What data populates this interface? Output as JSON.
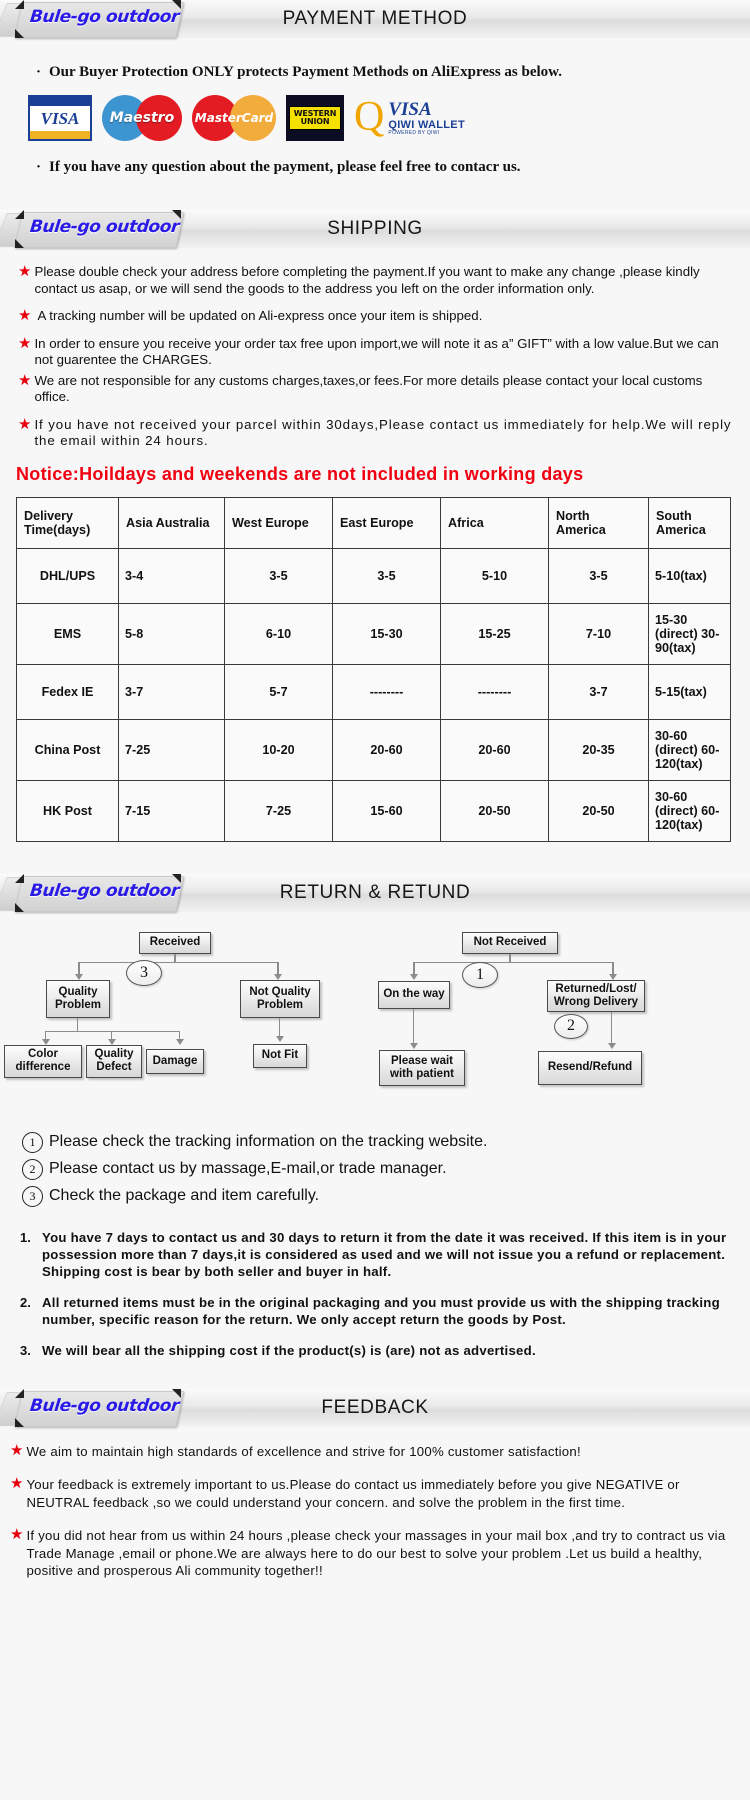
{
  "brand": "Bule-go outdoor",
  "sections": {
    "payment": {
      "title": "PAYMENT METHOD",
      "line1": "Our Buyer Protection ONLY protects Payment Methods on AliExpress as below.",
      "line2": "If you have any question about the payment, please feel free to contacr us.",
      "cards": [
        {
          "name": "visa-card-logo",
          "label": "VISA"
        },
        {
          "name": "maestro-card-logo",
          "label": "Maestro"
        },
        {
          "name": "mastercard-card-logo",
          "label": "MasterCard"
        },
        {
          "name": "western-union-logo",
          "label1": "WESTERN",
          "label2": "UNION"
        },
        {
          "name": "qiwi-wallet-logo",
          "label": "VISA",
          "sub": "QIWI WALLET",
          "fine": "POWERED BY QIWI"
        }
      ]
    },
    "shipping": {
      "title": "SHIPPING",
      "bullets": [
        "Please double check your address before completing the payment.If you want to make any change ,please kindly contact us asap, or we will send the goods to the address you left on the order information only.",
        "A tracking number will be updated on Ali-express once your item is shipped.",
        "In order to ensure you receive your order tax free upon import,we will note it as a” GIFT” with a low value.But we can not guarentee the CHARGES.",
        "We are not responsible for any customs charges,taxes,or fees.For more details please contact your local customs office.",
        "If you have not received your parcel within 30days,Please contact us immediately for help.We will reply the email within 24 hours."
      ],
      "notice": "Notice:Hoildays and weekends are not included in working days",
      "table": {
        "headers": [
          "Delivery Time(days)",
          "Asia Australia",
          "West Europe",
          "East Europe",
          "Africa",
          "North America",
          "South America"
        ],
        "rows": [
          {
            "method": "DHL/UPS",
            "cells": [
              "3-4",
              "3-5",
              "3-5",
              "5-10",
              "3-5",
              "5-10(tax)"
            ]
          },
          {
            "method": "EMS",
            "cells": [
              "5-8",
              "6-10",
              "15-30",
              "15-25",
              "7-10",
              "15-30 (direct) 30-90(tax)"
            ]
          },
          {
            "method": "Fedex IE",
            "cells": [
              "3-7",
              "5-7",
              "--------",
              "--------",
              "3-7",
              "5-15(tax)"
            ]
          },
          {
            "method": "China Post",
            "cells": [
              "7-25",
              "10-20",
              "20-60",
              "20-60",
              "20-35",
              "30-60 (direct) 60-120(tax)"
            ]
          },
          {
            "method": "HK Post",
            "cells": [
              "7-15",
              "7-25",
              "15-60",
              "20-50",
              "20-50",
              "30-60 (direct) 60-120(tax)"
            ]
          }
        ]
      }
    },
    "return": {
      "title": "RETURN & RETUND",
      "flow": {
        "received": "Received",
        "quality_problem": "Quality Problem",
        "not_quality_problem": "Not Quality Problem",
        "color_difference": "Color difference",
        "quality_defect": "Quality Defect",
        "damage": "Damage",
        "not_fit": "Not Fit",
        "not_received": "Not  Received",
        "on_the_way": "On the way",
        "returned_lost": "Returned/Lost/ Wrong Delivery",
        "please_wait": "Please wait with patient",
        "resend_refund": "Resend/Refund",
        "marker1": "1",
        "marker2": "2",
        "marker3": "3"
      },
      "numbered": [
        {
          "n": "①",
          "text": "Please check the tracking information on the tracking website."
        },
        {
          "n": "②",
          "text": "Please contact us by  massage,E-mail,or trade manager."
        },
        {
          "n": "③",
          "text": "Check the package and item carefully."
        }
      ],
      "policies": [
        {
          "n": "1.",
          "text": "You have 7 days to contact us and 30 days to return it from the date it was received. If this item is in your possession more than 7 days,it is considered as used and we will not issue you a refund or replacement. Shipping cost is bear by both seller and buyer in half."
        },
        {
          "n": "2.",
          "text": "All returned items must be in the original packaging and you must provide us with the shipping tracking number, specific reason for the return. We only accept return the goods by Post."
        },
        {
          "n": "3.",
          "text": "We will bear all the shipping cost if the product(s) is (are) not as advertised."
        }
      ]
    },
    "feedback": {
      "title": "FEEDBACK",
      "bullets": [
        "We aim to maintain high standards of excellence and strive  for 100% customer satisfaction!",
        "Your feedback is extremely important to us.Please do contact us immediately before you give NEGATIVE or NEUTRAL feedback ,so  we could understand your concern. and solve the problem in the first time.",
        "If you did not hear from us within 24 hours ,please check your massages in your mail box ,and try to contract us via Trade Manage ,email or phone.We are always here to do our best to solve your problem .Let us build a healthy, positive and prosperous Ali community together!!"
      ]
    }
  },
  "colors": {
    "brand": "#2a1ae8",
    "star": "#e8000d",
    "notice": "#f00010"
  }
}
